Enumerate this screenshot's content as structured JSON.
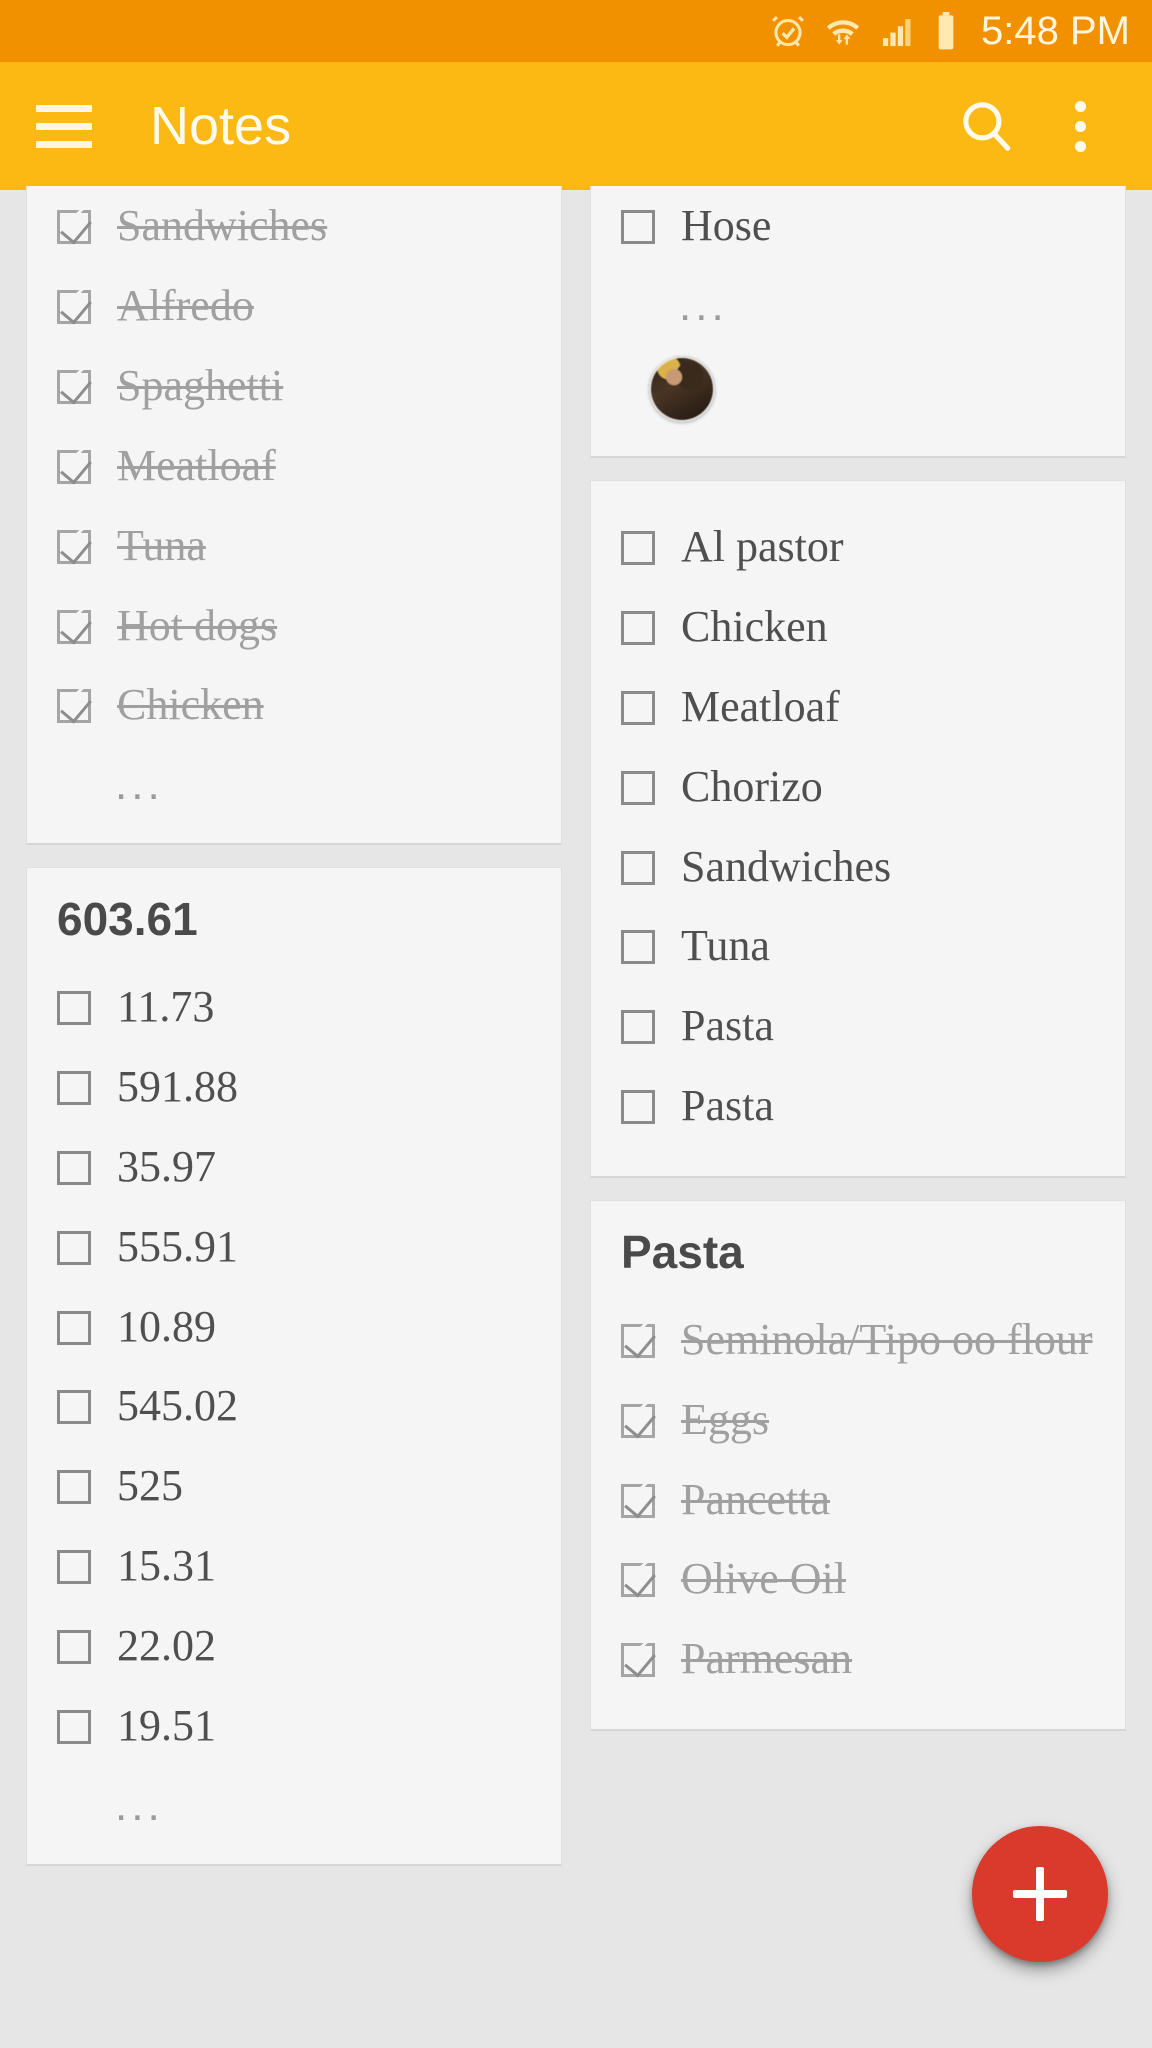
{
  "status_bar": {
    "time": "5:48 PM",
    "icons": [
      "alarm-clock-icon",
      "wifi-icon",
      "cellular-signal-icon",
      "battery-icon"
    ],
    "background_color": "#f29100"
  },
  "app_bar": {
    "title": "Notes",
    "menu_icon": "hamburger-menu-icon",
    "search_icon": "search-icon",
    "overflow_icon": "more-vertical-icon",
    "background_color": "#fdb913"
  },
  "fab": {
    "label": "+",
    "icon": "plus-icon",
    "color": "#d93a2b"
  },
  "notes": {
    "left_column": [
      {
        "id": "note-meals-checked",
        "title": "",
        "clipped_top": true,
        "items": [
          {
            "text": "Sandwiches",
            "checked": true
          },
          {
            "text": "Alfredo",
            "checked": true
          },
          {
            "text": "Spaghetti",
            "checked": true
          },
          {
            "text": "Meatloaf",
            "checked": true
          },
          {
            "text": "Tuna",
            "checked": true
          },
          {
            "text": "Hot dogs",
            "checked": true
          },
          {
            "text": "Chicken",
            "checked": true
          }
        ],
        "ellipsis": "..."
      },
      {
        "id": "note-numbers",
        "title": "603.61",
        "clipped_top": false,
        "items": [
          {
            "text": "11.73",
            "checked": false
          },
          {
            "text": "591.88",
            "checked": false
          },
          {
            "text": "35.97",
            "checked": false
          },
          {
            "text": "555.91",
            "checked": false
          },
          {
            "text": "10.89",
            "checked": false
          },
          {
            "text": "545.02",
            "checked": false
          },
          {
            "text": "525",
            "checked": false
          },
          {
            "text": "15.31",
            "checked": false
          },
          {
            "text": "22.02",
            "checked": false
          },
          {
            "text": "19.51",
            "checked": false
          }
        ],
        "ellipsis": "..."
      }
    ],
    "right_column": [
      {
        "id": "note-hose",
        "title": "",
        "clipped_top": true,
        "items": [
          {
            "text": "Hose",
            "checked": false
          }
        ],
        "ellipsis": "...",
        "avatar": "user-avatar"
      },
      {
        "id": "note-tacos",
        "title": "",
        "clipped_top": false,
        "items": [
          {
            "text": "Al pastor",
            "checked": false
          },
          {
            "text": "Chicken",
            "checked": false
          },
          {
            "text": "Meatloaf",
            "checked": false
          },
          {
            "text": "Chorizo",
            "checked": false
          },
          {
            "text": "Sandwiches",
            "checked": false
          },
          {
            "text": "Tuna",
            "checked": false
          },
          {
            "text": "Pasta",
            "checked": false
          },
          {
            "text": "Pasta",
            "checked": false
          }
        ],
        "ellipsis": ""
      },
      {
        "id": "note-pasta",
        "title": "Pasta",
        "clipped_top": false,
        "items": [
          {
            "text": "Seminola/Tipo oo flour",
            "checked": true
          },
          {
            "text": "Eggs",
            "checked": true
          },
          {
            "text": "Pancetta",
            "checked": true
          },
          {
            "text": "Olive Oil",
            "checked": true
          },
          {
            "text": "Parmesan",
            "checked": true
          }
        ],
        "ellipsis": ""
      }
    ]
  }
}
